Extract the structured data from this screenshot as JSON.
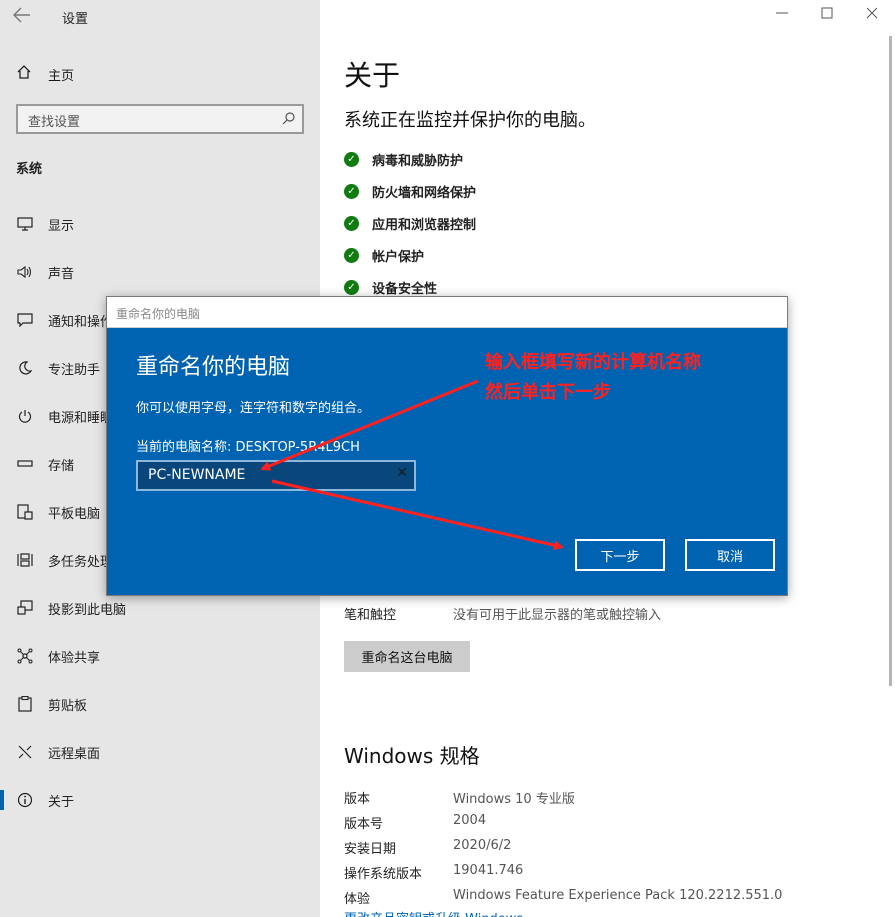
{
  "app": {
    "title": "设置"
  },
  "sidebar": {
    "home_label": "主页",
    "search_placeholder": "查找设置",
    "section_label": "系统",
    "items": [
      {
        "label": "显示",
        "icon": "monitor-icon"
      },
      {
        "label": "声音",
        "icon": "speaker-icon"
      },
      {
        "label": "通知和操作",
        "icon": "notification-icon"
      },
      {
        "label": "专注助手",
        "icon": "moon-icon"
      },
      {
        "label": "电源和睡眠",
        "icon": "power-icon"
      },
      {
        "label": "存储",
        "icon": "storage-icon"
      },
      {
        "label": "平板电脑",
        "icon": "tablet-icon"
      },
      {
        "label": "多任务处理",
        "icon": "multitask-icon"
      },
      {
        "label": "投影到此电脑",
        "icon": "project-icon"
      },
      {
        "label": "体验共享",
        "icon": "share-icon"
      },
      {
        "label": "剪贴板",
        "icon": "clipboard-icon"
      },
      {
        "label": "远程桌面",
        "icon": "remote-icon"
      },
      {
        "label": "关于",
        "icon": "info-icon",
        "active": true
      }
    ]
  },
  "main": {
    "title": "关于",
    "subtitle": "系统正在监控并保护你的电脑。",
    "security_items": [
      "病毒和威胁防护",
      "防火墙和网络保护",
      "应用和浏览器控制",
      "帐户保护",
      "设备安全性"
    ],
    "pen_label": "笔和触控",
    "pen_value": "没有可用于此显示器的笔或触控输入",
    "rename_button": "重命名这台电脑",
    "spec_title": "Windows 规格",
    "spec_rows": [
      {
        "k": "版本",
        "v": "Windows 10 专业版"
      },
      {
        "k": "版本号",
        "v": "2004"
      },
      {
        "k": "安装日期",
        "v": "2020/6/2"
      },
      {
        "k": "操作系统版本",
        "v": "19041.746"
      },
      {
        "k": "体验",
        "v": "Windows Feature Experience Pack 120.2212.551.0"
      }
    ],
    "cutoff_link": "更改产品密钥或升级 Windows"
  },
  "dialog": {
    "titlebar": "重命名你的电脑",
    "heading": "重命名你的电脑",
    "description": "你可以使用字母，连字符和数字的组合。",
    "current_name": "当前的电脑名称: DESKTOP-5R4L9CH",
    "input_value": "PC-NEWNAME",
    "next_button": "下一步",
    "cancel_button": "取消"
  },
  "annotation": {
    "line1": "输入框填写新的计算机名称",
    "line2": "然后单击下一步",
    "color": "#ff2020"
  },
  "colors": {
    "accent": "#0063b1",
    "ok": "#107c10",
    "sidebar_bg": "#e6e6e6"
  }
}
